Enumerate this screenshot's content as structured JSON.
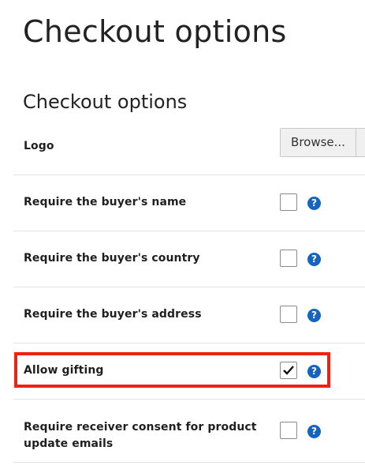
{
  "page": {
    "title": "Checkout options"
  },
  "section": {
    "title": "Checkout options"
  },
  "logo": {
    "label": "Logo",
    "browse_label": "Browse..."
  },
  "options": [
    {
      "label": "Require the buyer's name",
      "checked": false,
      "help": "?"
    },
    {
      "label": "Require the buyer's country",
      "checked": false,
      "help": "?"
    },
    {
      "label": "Require the buyer's address",
      "checked": false,
      "help": "?"
    },
    {
      "label": "Allow gifting",
      "checked": true,
      "help": "?"
    },
    {
      "label": "Require receiver consent for product update emails",
      "checked": false,
      "help": "?"
    }
  ],
  "colors": {
    "help_icon": "#1565c0",
    "highlight_border": "#ee2211"
  }
}
